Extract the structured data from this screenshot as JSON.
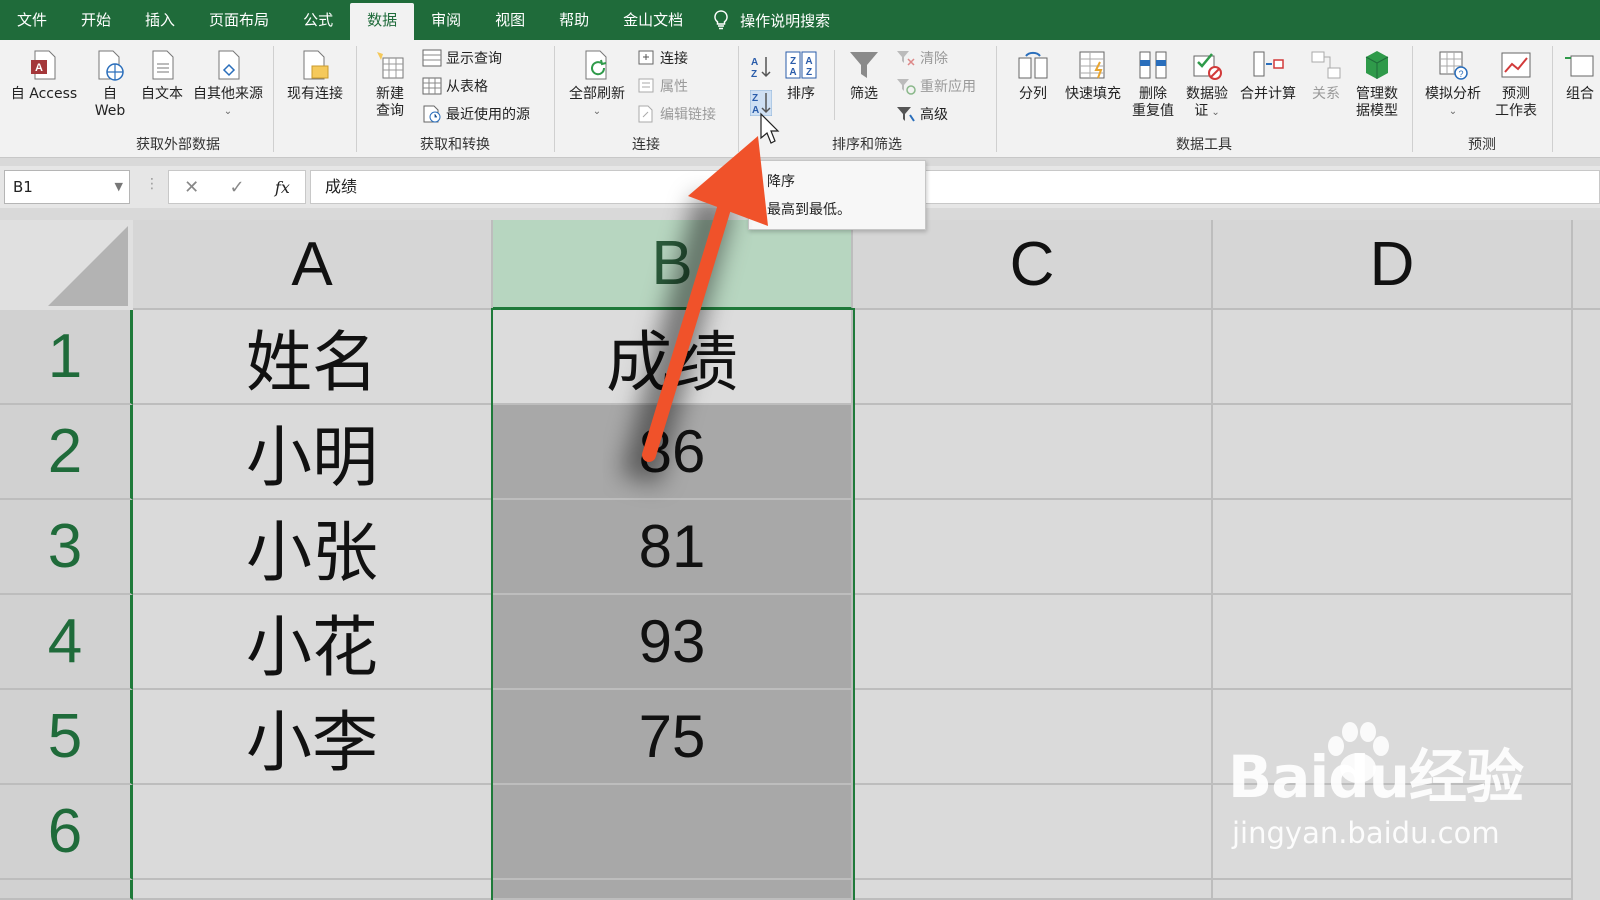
{
  "menubar": {
    "items": [
      "文件",
      "开始",
      "插入",
      "页面布局",
      "公式",
      "数据",
      "审阅",
      "视图",
      "帮助",
      "金山文档"
    ],
    "active": "数据",
    "tell_me": "操作说明搜索"
  },
  "ribbon": {
    "get_external": {
      "access": "自 Access",
      "web_line1": "自",
      "web_line2": "Web",
      "text": "自文本",
      "other": "自其他来源",
      "existing": "现有连接",
      "label": "获取外部数据"
    },
    "get_transform": {
      "new_query_line1": "新建",
      "new_query_line2": "查询",
      "show_query": "显示查询",
      "from_table": "从表格",
      "recent_sources": "最近使用的源",
      "label": "获取和转换"
    },
    "connections": {
      "refresh_all": "全部刷新",
      "connections": "连接",
      "properties": "属性",
      "edit_links": "编辑链接",
      "label": "连接"
    },
    "sort_filter": {
      "sort": "排序",
      "filter": "筛选",
      "clear": "清除",
      "reapply": "重新应用",
      "advanced": "高级",
      "label": "排序和筛选"
    },
    "data_tools": {
      "text_to_columns": "分列",
      "flash_fill": "快速填充",
      "remove_dup_line1": "删除",
      "remove_dup_line2": "重复值",
      "validation_line1": "数据验",
      "validation_line2": "证",
      "consolidate": "合并计算",
      "relationships": "关系",
      "data_model_line1": "管理数",
      "data_model_line2": "据模型",
      "label": "数据工具"
    },
    "forecast": {
      "what_if": "模拟分析",
      "sheet_line1": "预测",
      "sheet_line2": "工作表",
      "label": "预测"
    },
    "outline": {
      "group": "组合"
    }
  },
  "formula_bar": {
    "name_box": "B1",
    "fx": "fx",
    "content": "成绩"
  },
  "tooltip": {
    "line1": "降序",
    "line2": "最高到最低。"
  },
  "sheet": {
    "columns": [
      "A",
      "B",
      "C",
      "D"
    ],
    "rows": [
      "1",
      "2",
      "3",
      "4",
      "5",
      "6"
    ],
    "cells": [
      [
        "姓名",
        "成绩"
      ],
      [
        "小明",
        "86"
      ],
      [
        "小张",
        "81"
      ],
      [
        "小花",
        "93"
      ],
      [
        "小李",
        "75"
      ],
      [
        "",
        ""
      ]
    ]
  },
  "watermark": {
    "brand": "Baidu经验",
    "url": "jingyan.baidu.com"
  },
  "colors": {
    "excel_green": "#1f6b3a",
    "arrow": "#f0522a",
    "selection_border": "#1f7a3a"
  }
}
